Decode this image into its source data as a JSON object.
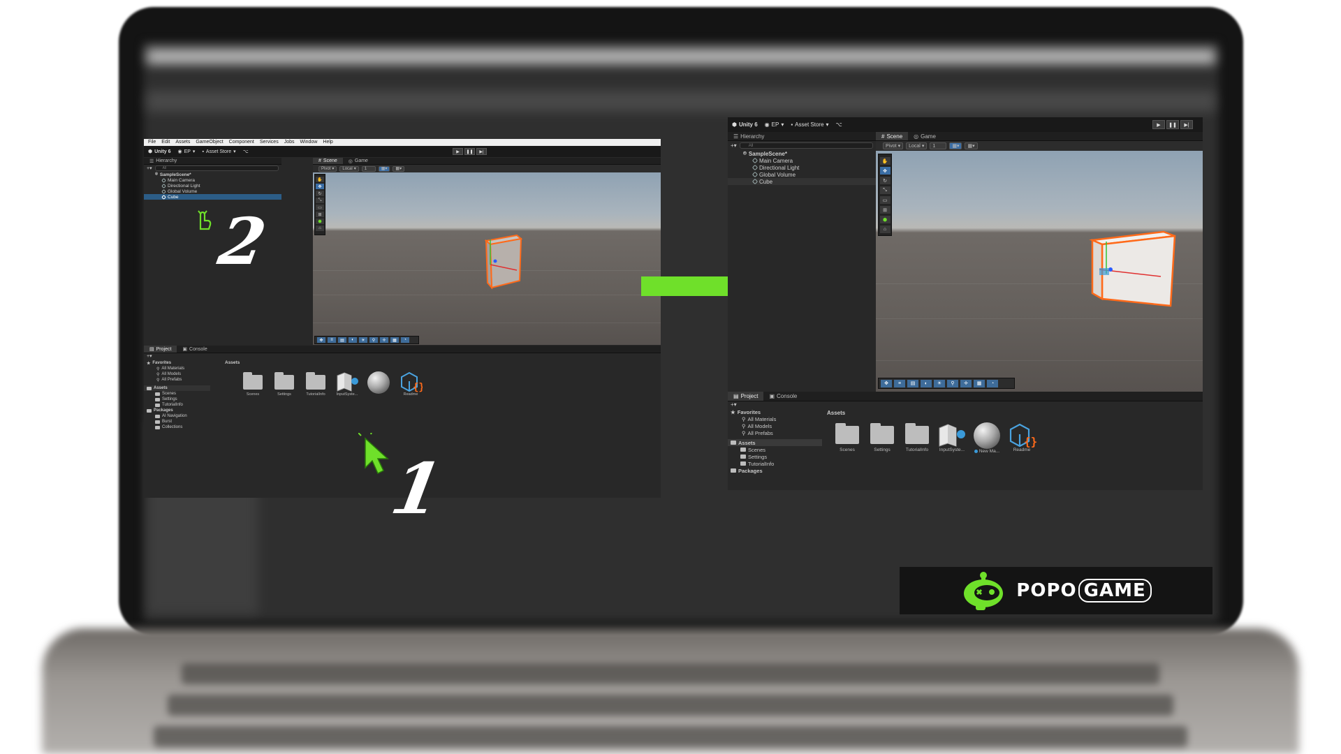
{
  "left_editor": {
    "menu": [
      "File",
      "Edit",
      "Assets",
      "GameObject",
      "Component",
      "Services",
      "Jobs",
      "Window",
      "Help"
    ],
    "toolbar": {
      "unity_label": "Unity 6",
      "account": "EP",
      "asset_store": "Asset Store"
    },
    "hierarchy": {
      "tab": "Hierarchy",
      "search_placeholder": "All",
      "scene": "SampleScene*",
      "items": [
        "Main Camera",
        "Directional Light",
        "Global Volume",
        "Cube"
      ],
      "selected_index": 3
    },
    "scene_tabs": [
      "Scene",
      "Game"
    ],
    "scene_toolbar": {
      "pivot": "Pivot",
      "local": "Local",
      "snap": "1"
    },
    "bottom_tabs": [
      "Project",
      "Console"
    ],
    "project_tree": {
      "favorites": "Favorites",
      "favorite_items": [
        "All Materials",
        "All Models",
        "All Prefabs"
      ],
      "assets": "Assets",
      "asset_items": [
        "Scenes",
        "Settings",
        "TutorialInfo"
      ],
      "packages": "Packages",
      "package_items": [
        "AI Navigation",
        "Burst",
        "Collections"
      ]
    },
    "assets_header": "Assets",
    "assets": [
      "Scenes",
      "Settings",
      "TutorialInfo",
      "InputSyste...",
      "",
      "Readme"
    ]
  },
  "right_editor": {
    "toolbar": {
      "unity_label": "Unity 6",
      "account": "EP",
      "asset_store": "Asset Store"
    },
    "hierarchy": {
      "tab": "Hierarchy",
      "search_placeholder": "All",
      "scene": "SampleScene*",
      "items": [
        "Main Camera",
        "Directional Light",
        "Global Volume",
        "Cube"
      ]
    },
    "scene_tabs": [
      "Scene",
      "Game"
    ],
    "scene_toolbar": {
      "pivot": "Pivot",
      "local": "Local",
      "snap": "1"
    },
    "bottom_tabs": [
      "Project",
      "Console"
    ],
    "project_tree": {
      "favorites": "Favorites",
      "favorite_items": [
        "All Materials",
        "All Models",
        "All Prefabs"
      ],
      "assets": "Assets",
      "asset_items": [
        "Scenes",
        "Settings",
        "TutorialInfo"
      ],
      "packages": "Packages"
    },
    "assets_header": "Assets",
    "assets": [
      "Scenes",
      "Settings",
      "TutorialInfo",
      "InputSyste...",
      "New Ma...",
      "Readme"
    ]
  },
  "annotations": {
    "step_1": "1",
    "step_2": "2"
  },
  "logo": {
    "popo": "POPO",
    "game": "GAME"
  },
  "colors": {
    "arrow": "#6fe02a",
    "selection": "#2c5d87",
    "cube_outline": "#ff6a1a",
    "logo_green": "#6fe02a"
  }
}
